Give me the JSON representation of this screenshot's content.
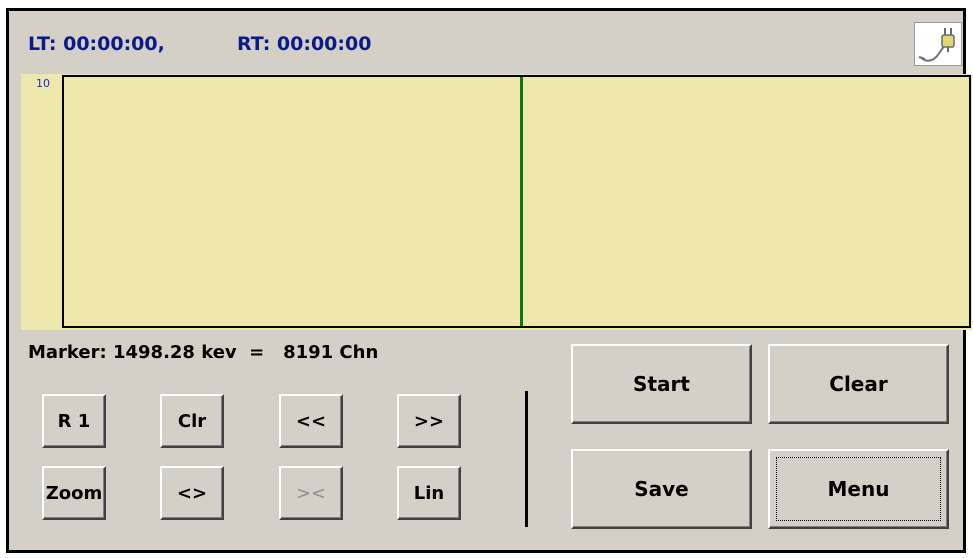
{
  "status": {
    "lt": "LT: 00:00:00,",
    "rt": "RT: 00:00:00"
  },
  "power_icon": "plug-icon",
  "plot": {
    "scale_label": "10",
    "background_color": "#efe8ac",
    "marker_color": "#0c7a0c"
  },
  "marker": {
    "text": "Marker: 1498.28 kev  =   8191 Chn"
  },
  "controls": {
    "r1": "R 1",
    "clr": "Clr",
    "prev": "<<",
    "next": ">>",
    "zoom": "Zoom",
    "expand": "<>",
    "shrink": "><",
    "lin": "Lin"
  },
  "actions": {
    "start": "Start",
    "clear": "Clear",
    "save": "Save",
    "menu": "Menu"
  }
}
